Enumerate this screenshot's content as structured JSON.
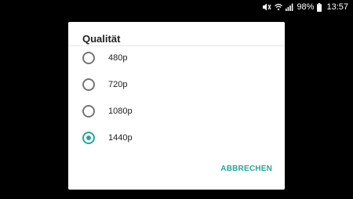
{
  "status_bar": {
    "icons": [
      "mute-icon",
      "wifi-icon",
      "signal-icon",
      "battery-icon"
    ],
    "battery_percent": "98%",
    "time": "13:57"
  },
  "dialog": {
    "title": "Qualität",
    "options": [
      {
        "label": "480p",
        "selected": false
      },
      {
        "label": "720p",
        "selected": false
      },
      {
        "label": "1080p",
        "selected": false
      },
      {
        "label": "1440p",
        "selected": true
      }
    ],
    "cancel_label": "ABBRECHEN"
  },
  "colors": {
    "accent": "#26a69a",
    "background": "#000000",
    "dialog_background": "#ffffff"
  }
}
